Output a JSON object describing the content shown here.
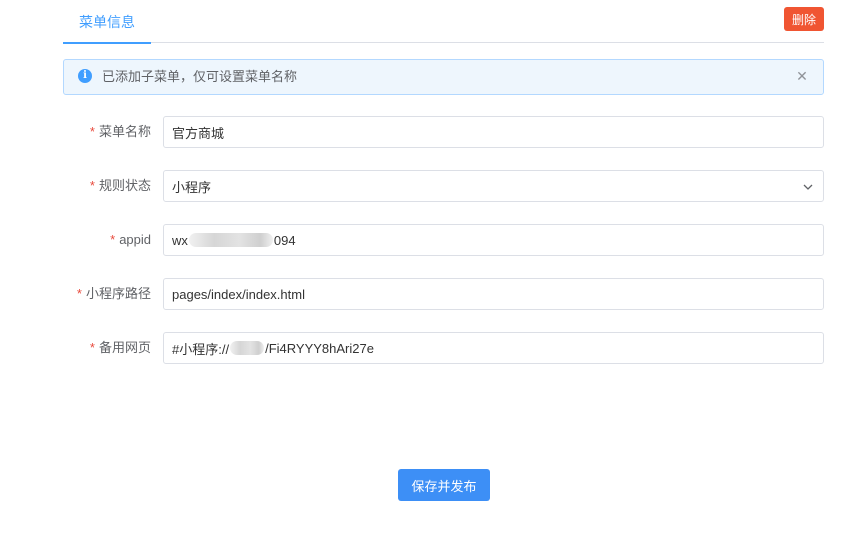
{
  "tabs": [
    {
      "label": "菜单信息",
      "active": true
    }
  ],
  "delete_label": "删除",
  "alert": {
    "text": "已添加子菜单，仅可设置菜单名称"
  },
  "form": {
    "required_mark": "*",
    "menu_name": {
      "label": "菜单名称",
      "value": "官方商城"
    },
    "rule_status": {
      "label": "规则状态",
      "value": "小程序"
    },
    "appid": {
      "label": "appid",
      "value_prefix": "wx",
      "value_suffix": "094"
    },
    "miniprogram_path": {
      "label": "小程序路径",
      "value": "pages/index/index.html"
    },
    "backup_page": {
      "label": "备用网页",
      "value_prefix": "#小程序://",
      "value_suffix": "/Fi4RYYY8hAri27e"
    }
  },
  "save_label": "保存并发布",
  "colors": {
    "primary": "#409eff",
    "danger": "#f05532",
    "required": "#e84a3c"
  }
}
